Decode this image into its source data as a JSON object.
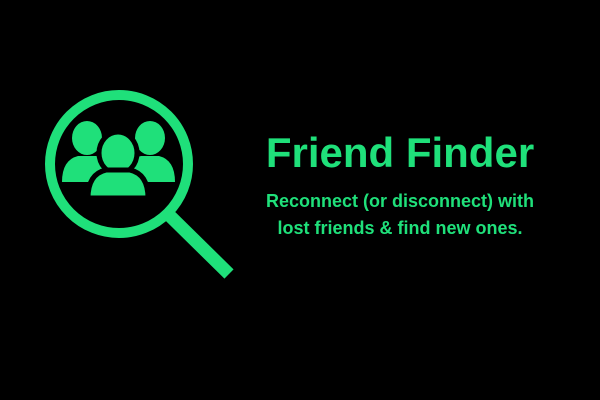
{
  "brand": {
    "title": "Friend Finder",
    "tagline_line1": "Reconnect (or disconnect) with",
    "tagline_line2": "lost friends & find new ones.",
    "accent_color": "#1fe07a",
    "background_color": "#000000"
  },
  "logo": {
    "icon": "magnifying-glass-with-people-icon"
  }
}
